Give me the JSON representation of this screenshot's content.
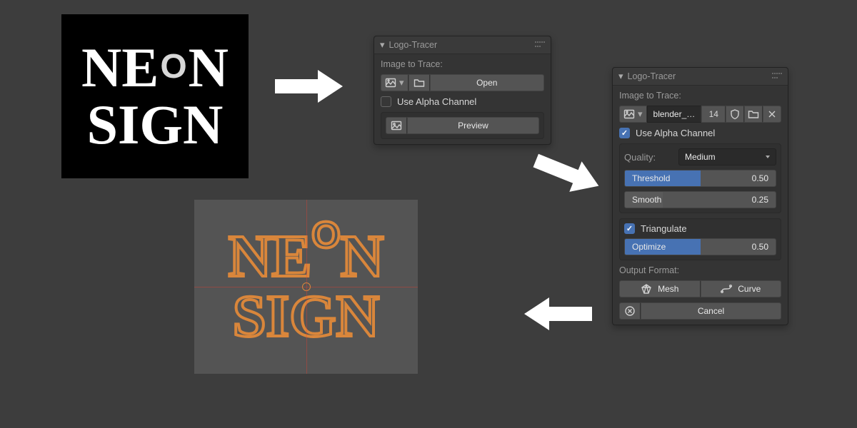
{
  "source_text": {
    "row1": "NE",
    "row1_small": "O",
    "row1_end": "N",
    "row2": "SIGN"
  },
  "panelA": {
    "title": "Logo-Tracer",
    "image_to_trace": "Image to Trace:",
    "open_btn": "Open",
    "use_alpha": "Use Alpha Channel",
    "preview_btn": "Preview"
  },
  "panelB": {
    "title": "Logo-Tracer",
    "image_to_trace": "Image to Trace:",
    "file_name": "blender_…",
    "file_count": "14",
    "use_alpha": "Use Alpha Channel",
    "quality_label": "Quality:",
    "quality_value": "Medium",
    "threshold_label": "Threshold",
    "threshold_value": "0.50",
    "threshold_fill": "50%",
    "smooth_label": "Smooth",
    "smooth_value": "0.25",
    "smooth_fill": "25%",
    "triangulate": "Triangulate",
    "optimize_label": "Optimize",
    "optimize_value": "0.50",
    "optimize_fill": "50%",
    "output_format": "Output Format:",
    "mesh_btn": "Mesh",
    "curve_btn": "Curve",
    "cancel_btn": "Cancel"
  },
  "traced_text": {
    "row1": "NE",
    "row1_small": "O",
    "row1_end": "N",
    "row2": "SIGN"
  }
}
